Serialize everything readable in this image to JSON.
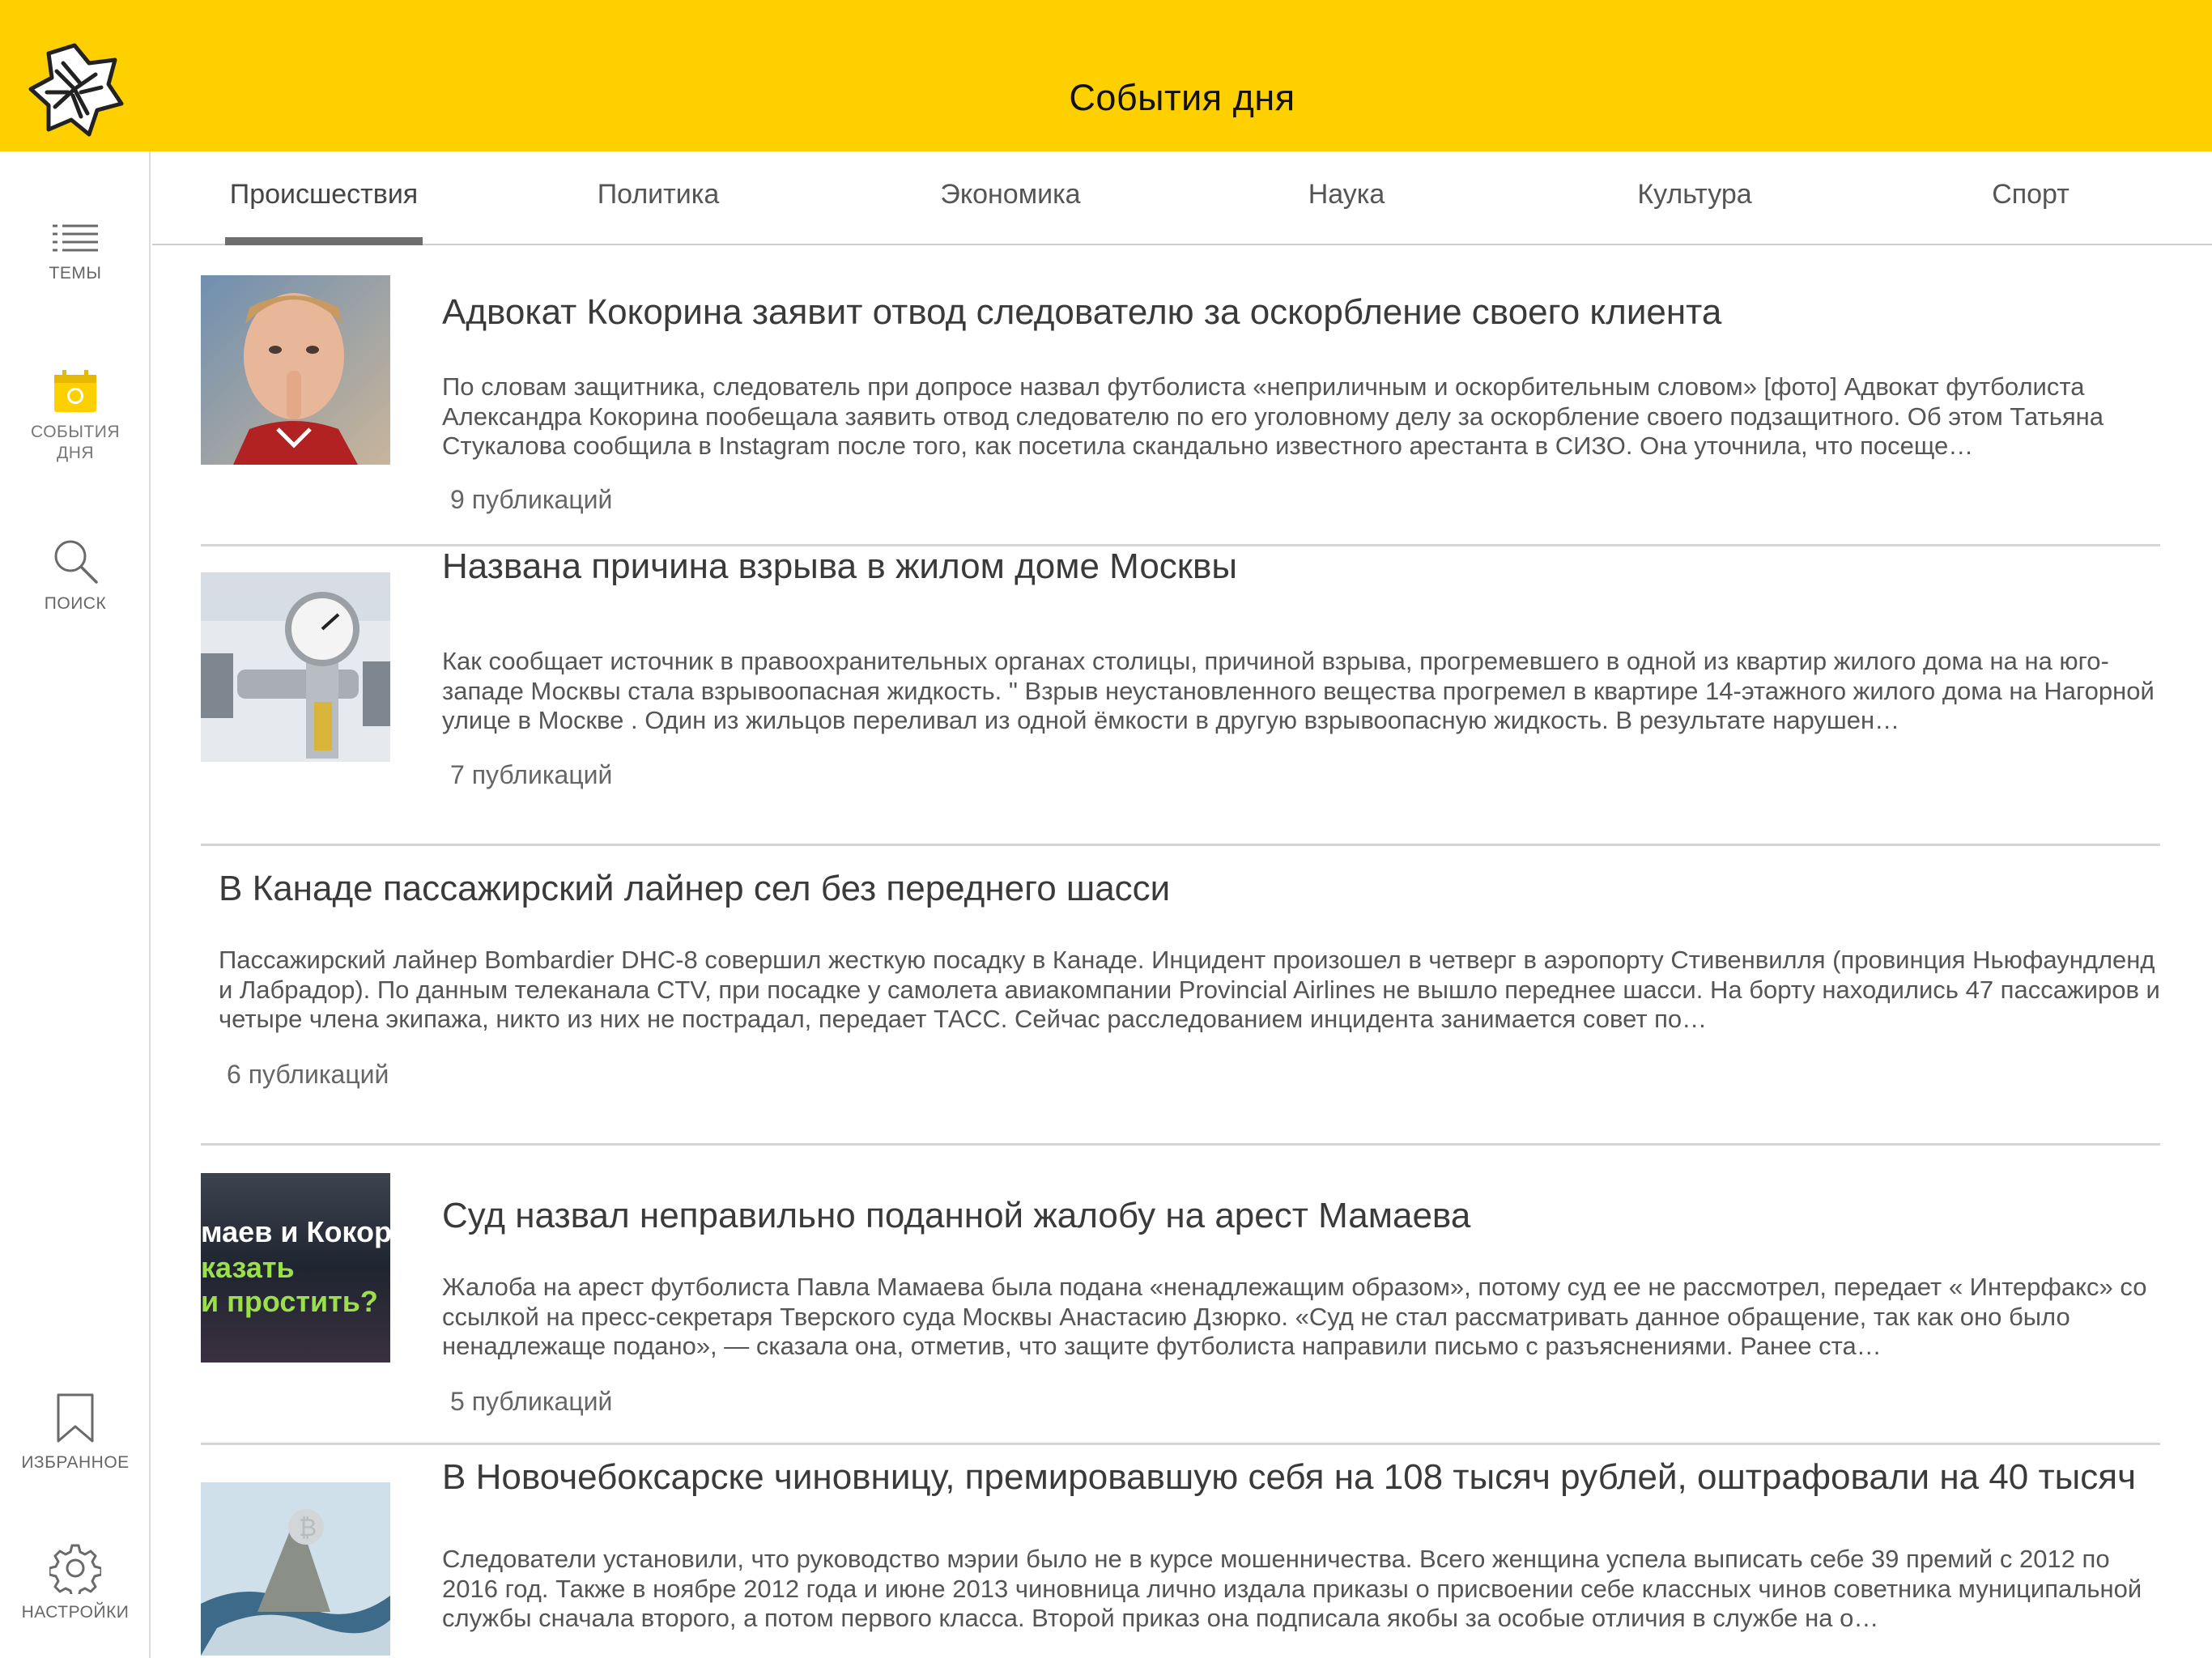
{
  "header": {
    "title": "События дня"
  },
  "sidebar": {
    "items": [
      {
        "label": "ТЕМЫ",
        "icon": "list-icon"
      },
      {
        "label": "СОБЫТИЯ ДНЯ",
        "icon": "calendar-icon"
      },
      {
        "label": "ПОИСК",
        "icon": "search-icon"
      },
      {
        "label": "ИЗБРАННОЕ",
        "icon": "bookmark-icon"
      },
      {
        "label": "НАСТРОЙКИ",
        "icon": "gear-icon"
      }
    ]
  },
  "tabs": [
    {
      "label": "Происшествия",
      "active": true
    },
    {
      "label": "Политика"
    },
    {
      "label": "Экономика"
    },
    {
      "label": "Наука"
    },
    {
      "label": "Культура"
    },
    {
      "label": "Спорт"
    }
  ],
  "articles": [
    {
      "title": "Адвокат Кокорина заявит отвод следователю за оскорбление своего клиента",
      "body": "По словам защитника, следователь при допросе назвал футболиста «неприличным и оскорбительным словом» [фото] Адвокат футболиста Александра Кокорина пообещала заявить отвод следователю по его уголовному делу за оскорбление своего подзащитного. Об этом Татьяна Стукалова сообщила в Instagram после того, как посетила скандально известного арестанта в СИЗО. Она уточнила, что посеще…",
      "count": "9 публикаций"
    },
    {
      "title": "Названа причина взрыва в жилом доме Москвы",
      "body": "Как сообщает источник в правоохранительных органах столицы, причиной взрыва, прогремевшего в одной из квартир жилого дома на на юго-западе Москвы стала взрывоопасная жидкость. \" Взрыв неустановленного вещества прогремел в квартире 14-этажного жилого дома на Нагорной улице в Москве . Один из жильцов переливал из одной ёмкости в другую взрывоопасную жидкость. В результате нарушен…",
      "count": "7 публикаций"
    },
    {
      "title": "В Канаде пассажирский лайнер сел без переднего шасси",
      "body": "Пассажирский лайнер Bombardier DHC-8 совершил жесткую посадку в Канаде. Инцидент произошел в четверг в аэропорту Стивенвилля (провинция Ньюфаундленд и Лабрадор). По данным телеканала CTV, при посадке у самолета авиакомпании Provincial Airlines не вышло переднее шасси. На борту находились 47 пассажиров и четыре члена экипажа, никто из них не пострадал, передает ТАСС. Сейчас расследованием инцидента занимается совет по…",
      "count": "6 публикаций"
    },
    {
      "title": "Суд назвал неправильно поданной жалобу на арест Мамаева",
      "body": "Жалоба на арест футболиста Павла Мамаева была подана «ненадлежащим образом», потому суд ее не рассмотрел, передает « Интерфакс» со ссылкой на пресс-секретаря Тверского суда Москвы Анастасию Дзюрко. «Суд не стал рассматривать данное обращение, так как оно было ненадлежаще подано», — сказала она, отметив, что защите футболиста направили письмо с разъяснениями. Ранее ста…",
      "count": "5 публикаций",
      "thumb_text": [
        "маев и Кокор",
        "казать",
        "и простить?"
      ]
    },
    {
      "title": "В Новочебоксарске чиновницу, премировавшую себя на 108 тысяч рублей, оштрафовали на 40 тысяч",
      "body": "Следователи установили, что руководство мэрии было не в курсе мошенничества. Всего женщина успела выписать себе 39 премий с 2012 по 2016 год. Также в ноябре 2012 года и июне 2013 чиновница лично издала приказы о присвоении себе классных чинов советника муниципальной службы сначала второго, а потом первого класса. Второй приказ она подписала якобы за особые отличия в службе на о…",
      "count": ""
    }
  ],
  "colors": {
    "header": "#ffd000",
    "accent": "#ffd000"
  }
}
